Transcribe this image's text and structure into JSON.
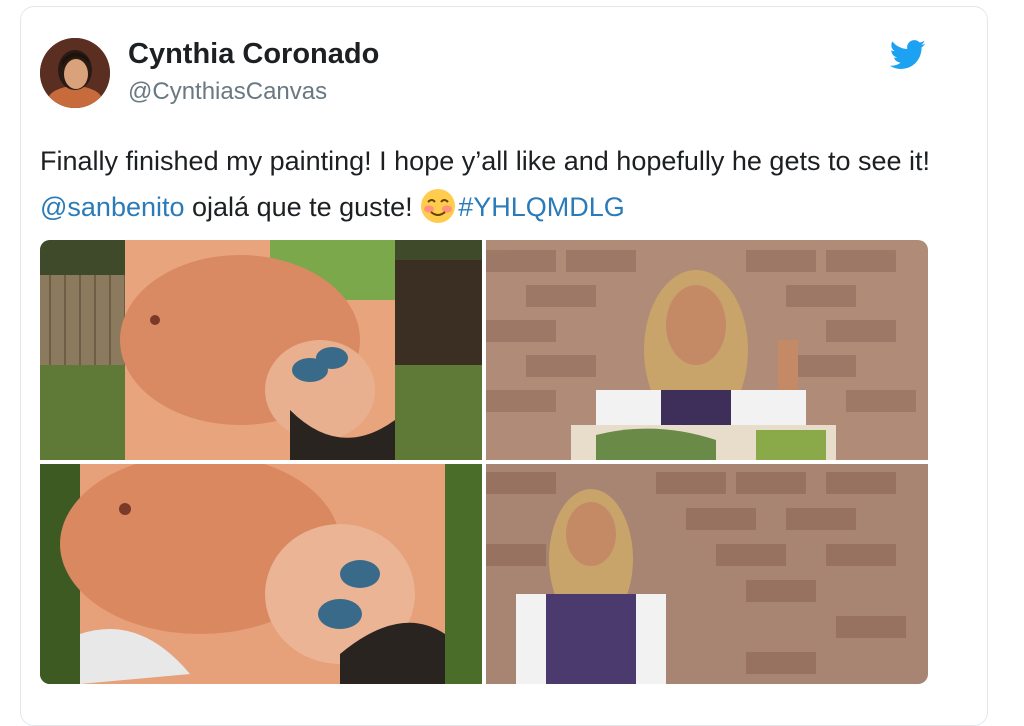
{
  "tweet": {
    "author": {
      "display_name": "Cynthia Coronado",
      "handle": "@CynthiasCanvas",
      "avatar_icon": "avatar"
    },
    "brand_icon": "twitter-bird-icon",
    "text": {
      "part1": "Finally finished my painting! I hope y’all like and hopefully he gets to see it! ",
      "mention": "@sanbenito",
      "part2": " ojalá que te guste! ",
      "emoji": "smiling-face-with-blush-emoji",
      "hashtag": "#YHLQMDLG"
    },
    "media": {
      "count": 4,
      "photos": [
        {
          "description_id": "painting-outdoor-fence"
        },
        {
          "description_id": "artist-brick-wall-peace-sign"
        },
        {
          "description_id": "painting-closeup-grass"
        },
        {
          "description_id": "artist-brick-wall-overalls"
        }
      ]
    }
  },
  "colors": {
    "link": "#2b7bb9",
    "twitter_blue": "#1da1f2",
    "text": "#1c2022",
    "secondary": "#697882",
    "border": "#e1e8ed"
  }
}
